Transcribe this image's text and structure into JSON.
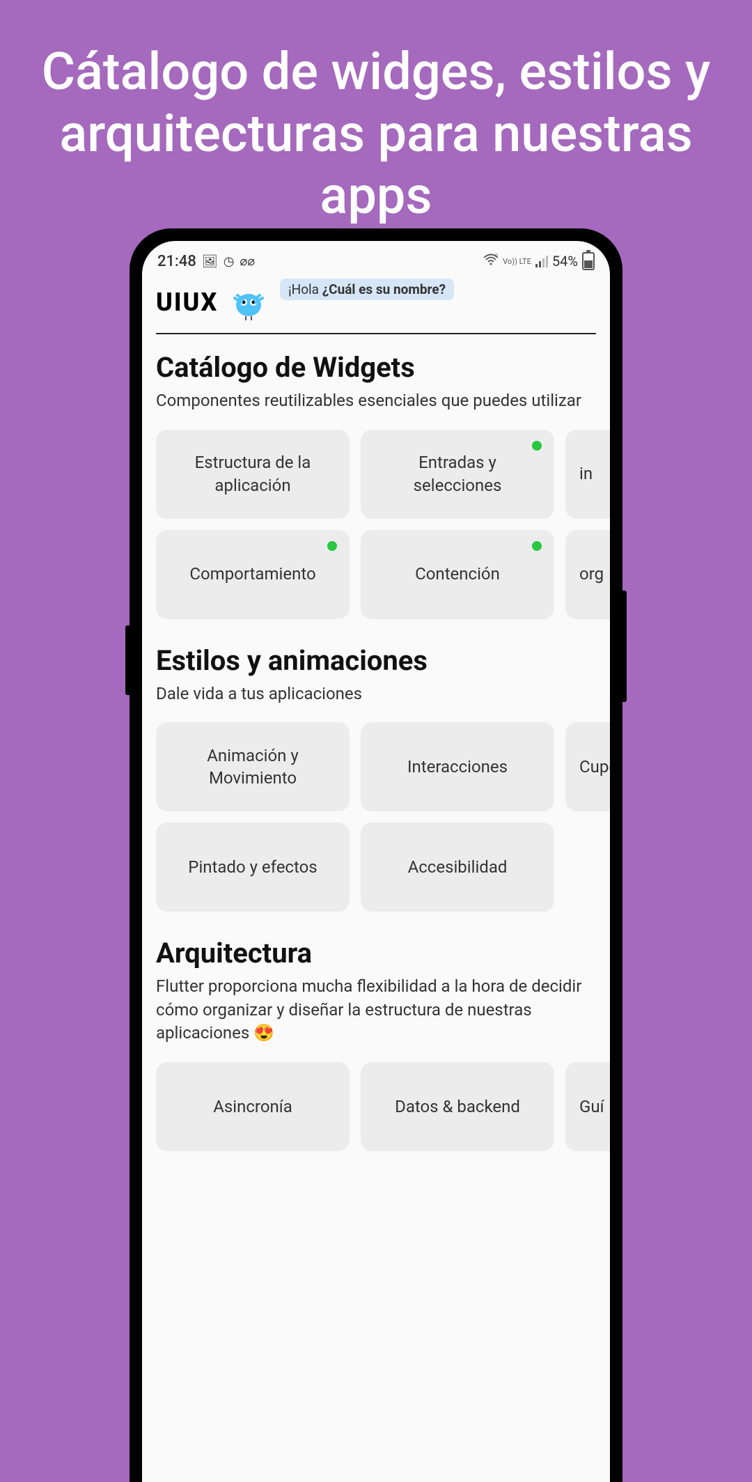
{
  "headline": "Cátalogo de widges, estilos y arquitecturas para nuestras apps",
  "statusbar": {
    "time": "21:48",
    "battery_pct": "54%",
    "network_label": "Vo)) LTE"
  },
  "appbar": {
    "title": "UIUX",
    "speech_prefix": "¡Hola ",
    "speech_bold": "¿Cuál es su nombre?"
  },
  "sections": [
    {
      "title": "Catálogo de Widgets",
      "subtitle": "Componentes reutilizables esenciales que puedes utilizar",
      "rows": [
        [
          {
            "label": "Estructura de la aplicación",
            "dot": false
          },
          {
            "label": "Entradas y selecciones",
            "dot": true
          },
          {
            "label": "in",
            "dot": false,
            "partial": true
          }
        ],
        [
          {
            "label": "Comportamiento",
            "dot": true
          },
          {
            "label": "Contención",
            "dot": true
          },
          {
            "label": "org",
            "dot": false,
            "partial": true
          }
        ]
      ]
    },
    {
      "title": "Estilos y animaciones",
      "subtitle": "Dale vida a tus aplicaciones",
      "rows": [
        [
          {
            "label": "Animación y Movimiento",
            "dot": false
          },
          {
            "label": "Interacciones",
            "dot": false
          },
          {
            "label": "Cupe",
            "dot": false,
            "partial": true
          }
        ],
        [
          {
            "label": "Pintado y efectos",
            "dot": false
          },
          {
            "label": "Accesibilidad",
            "dot": false
          }
        ]
      ]
    },
    {
      "title": "Arquitectura",
      "subtitle": "Flutter proporciona mucha flexibilidad a la hora de decidir cómo organizar y diseñar la estructura de nuestras aplicaciones 😍",
      "rows": [
        [
          {
            "label": "Asincronía",
            "dot": false
          },
          {
            "label": "Datos & backend",
            "dot": false
          },
          {
            "label": "Guí",
            "dot": false,
            "partial": true
          }
        ]
      ]
    }
  ]
}
